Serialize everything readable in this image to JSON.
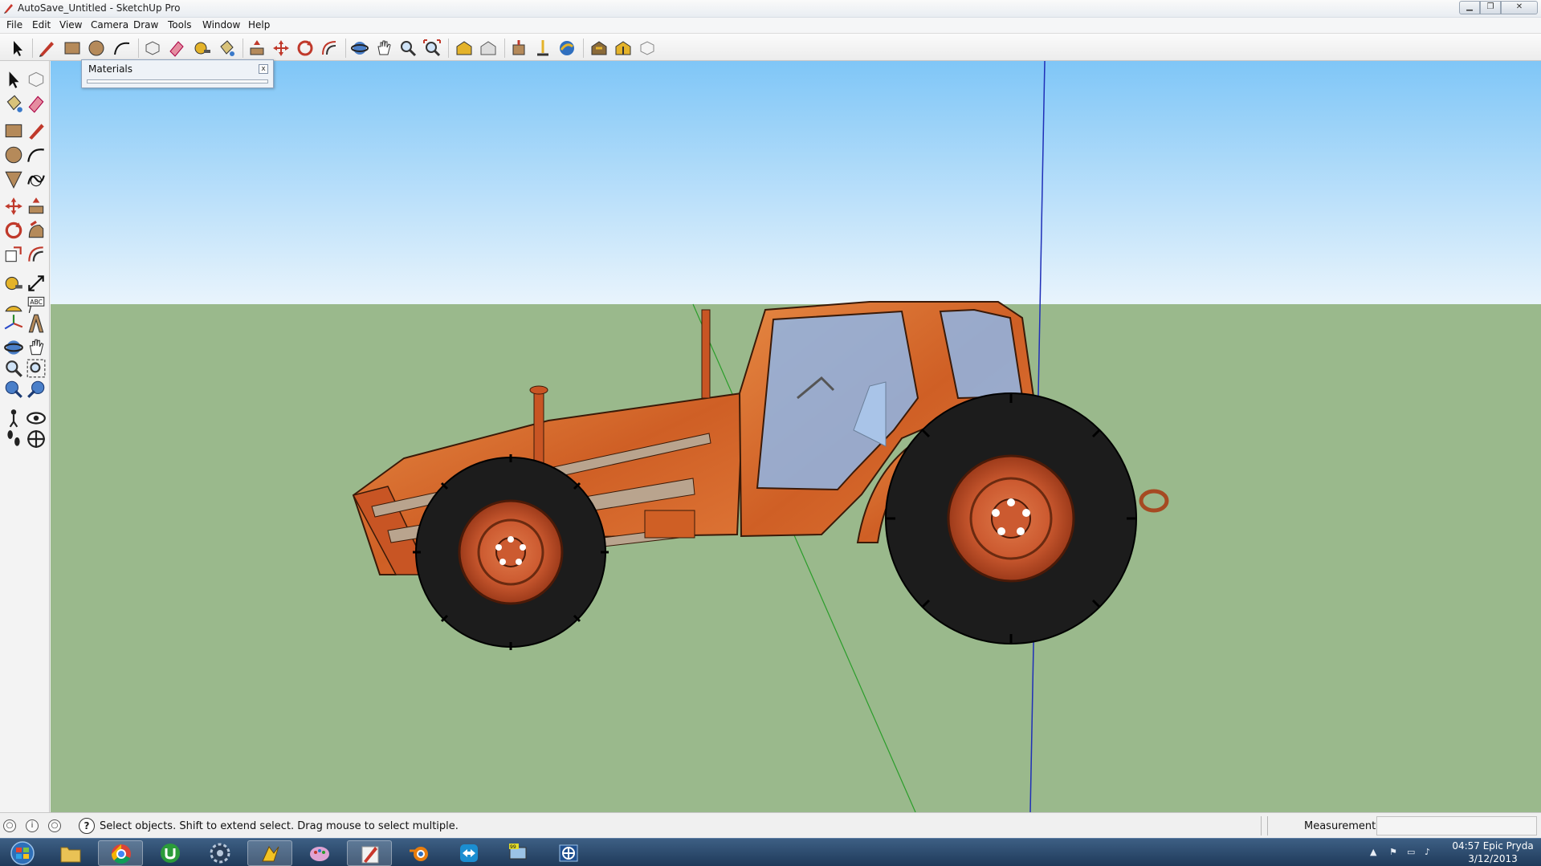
{
  "window": {
    "title": "AutoSave_Untitled - SketchUp Pro"
  },
  "menu": [
    "File",
    "Edit",
    "View",
    "Camera",
    "Draw",
    "Tools",
    "Window",
    "Help"
  ],
  "toolbar": {
    "top_icons": [
      "select-icon",
      "pencil-icon",
      "rectangle-icon",
      "circle-icon",
      "arc-icon",
      "make-component-icon",
      "eraser-icon",
      "tape-measure-icon",
      "paint-bucket-icon",
      "push-pull-icon",
      "move-icon",
      "rotate-icon",
      "offset-icon",
      "orbit-icon",
      "pan-icon",
      "zoom-icon",
      "zoom-extents-icon",
      "warehouse-icon",
      "share-model-icon",
      "component-icon",
      "position-camera-icon",
      "google-earth-icon",
      "extension-warehouse-icon",
      "share-component-icon",
      "layout-icon"
    ],
    "left_icons": [
      "select-icon",
      "make-component-icon",
      "paint-bucket-icon",
      "eraser-icon",
      "rectangle-icon",
      "line-icon",
      "circle-icon",
      "arc-icon",
      "polygon-icon",
      "freehand-icon",
      "move-icon",
      "push-pull-icon",
      "rotate-icon",
      "follow-me-icon",
      "scale-icon",
      "offset-icon",
      "tape-measure-icon",
      "dimension-icon",
      "protractor-icon",
      "text-icon",
      "axes-icon",
      "3d-text-icon",
      "orbit-icon",
      "pan-icon",
      "zoom-icon",
      "zoom-window-icon",
      "previous-view-icon",
      "next-view-icon",
      "position-camera-icon",
      "look-around-icon",
      "walk-icon",
      "section-plane-icon"
    ]
  },
  "materials_panel": {
    "title": "Materials",
    "close_glyph": "x"
  },
  "statusbar": {
    "help_glyph": "?",
    "hint": "Select objects. Shift to extend select. Drag mouse to select multiple.",
    "measurements_label": "Measurements",
    "measurements_value": ""
  },
  "taskbar": {
    "apps": [
      "start-orb-icon",
      "windows-explorer-icon",
      "chrome-icon",
      "utorrent-icon",
      "steam-icon",
      "winamp-icon",
      "paint-icon",
      "sketchup-icon",
      "blender-icon",
      "teamviewer-icon",
      "monitor-icon",
      "network-icon"
    ],
    "active_app": "sketchup-icon",
    "clock_time": "04:57 Epic Pryda",
    "clock_date": "3/12/2013"
  },
  "colors": {
    "sky_top": "#7fc6f7",
    "sky_bottom": "#e9f4fc",
    "ground": "#9ab98c",
    "tractor_body": "#d86a2e",
    "tire": "#1c1c1c",
    "glass": "#8fb6e8",
    "taskbar": "#2b4a6e"
  }
}
